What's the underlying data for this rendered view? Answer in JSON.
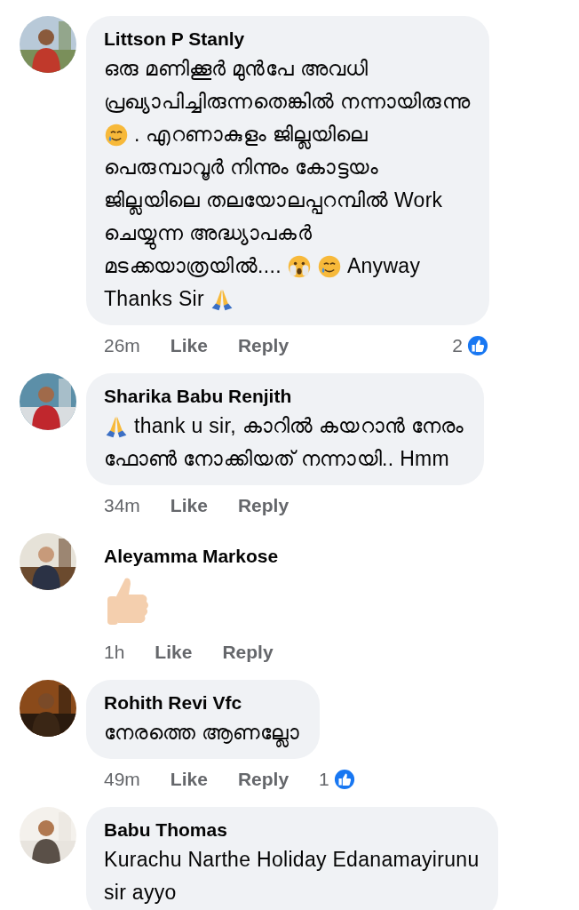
{
  "comments": [
    {
      "author": "Littson P Stanly",
      "kind": "bubble",
      "lines": [
        [
          {
            "kind": "text",
            "text": "ഒരു മണിക്കൂർ മുൻപേ അവധി"
          }
        ],
        [
          {
            "kind": "text",
            "text": "പ്രഖ്യാപിച്ചിരുന്നതെങ്കിൽ നന്നായിരുന്നു"
          }
        ],
        [
          {
            "kind": "smile_tear"
          },
          {
            "kind": "text",
            "text": ". എറണാകുളം ജില്ലയിലെ"
          }
        ],
        [
          {
            "kind": "text",
            "text": "പെരുമ്പാവൂർ നിന്നും കോട്ടയം"
          }
        ],
        [
          {
            "kind": "text",
            "text": "ജില്ലയിലെ തലയോലപ്പറമ്പിൽ Work"
          }
        ],
        [
          {
            "kind": "text",
            "text": "ചെയ്യുന്ന അദ്ധ്യാപകർ"
          }
        ],
        [
          {
            "kind": "text",
            "text": "മടക്കയാത്രയിൽ...."
          },
          {
            "kind": "scream"
          },
          {
            "kind": "smile_tear"
          },
          {
            "kind": "text",
            "text": "Anyway"
          }
        ],
        [
          {
            "kind": "text",
            "text": "Thanks Sir"
          },
          {
            "kind": "pray"
          }
        ]
      ],
      "time": "26m",
      "like": "Like",
      "reply": "Reply",
      "reaction_count": "2"
    },
    {
      "author": "Sharika Babu Renjith",
      "kind": "bubble",
      "lines": [
        [
          {
            "kind": "pray"
          },
          {
            "kind": "text",
            "text": "thank u sir, കാറിൽ കയറാൻ നേരം"
          }
        ],
        [
          {
            "kind": "text",
            "text": "ഫോൺ നോക്കിയത് നന്നായി.. Hmm"
          }
        ]
      ],
      "time": "34m",
      "like": "Like",
      "reply": "Reply"
    },
    {
      "author": "Aleyamma Markose",
      "kind": "sticker",
      "time": "1h",
      "like": "Like",
      "reply": "Reply"
    },
    {
      "author": "Rohith Revi Vfc",
      "kind": "bubble",
      "lines": [
        [
          {
            "kind": "text",
            "text": "നേരത്തെ ആണല്ലോ"
          }
        ]
      ],
      "time": "49m",
      "like": "Like",
      "reply": "Reply",
      "reaction_count": "1"
    },
    {
      "author": "Babu Thomas",
      "kind": "bubble",
      "lines": [
        [
          {
            "kind": "text",
            "text": "Kurachu Narthe Holiday Edanamayirunu"
          }
        ],
        [
          {
            "kind": "text",
            "text": "sir ayyo"
          }
        ]
      ]
    }
  ]
}
